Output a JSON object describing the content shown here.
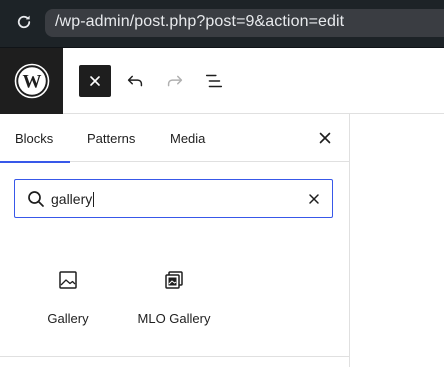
{
  "browser": {
    "url": "/wp-admin/post.php?post=9&action=edit",
    "reload_icon": "reload-icon"
  },
  "header": {
    "logo_icon": "wordpress-logo-icon",
    "toggle_inserter_icon": "close-icon",
    "undo_icon": "undo-icon",
    "redo_icon": "redo-icon",
    "list_view_icon": "list-view-icon"
  },
  "inserter": {
    "tabs": [
      {
        "label": "Blocks",
        "active": true
      },
      {
        "label": "Patterns",
        "active": false
      },
      {
        "label": "Media",
        "active": false
      }
    ],
    "close_icon": "close-icon",
    "search": {
      "value": "gallery",
      "icon": "search-icon",
      "clear_icon": "close-icon"
    },
    "results": [
      {
        "label": "Gallery",
        "icon": "gallery-icon"
      },
      {
        "label": "MLO Gallery",
        "icon": "mlo-gallery-icon"
      }
    ]
  },
  "colors": {
    "accent": "#3858e9",
    "dark": "#1e1e1e",
    "browser_bar": "#1d2327"
  }
}
